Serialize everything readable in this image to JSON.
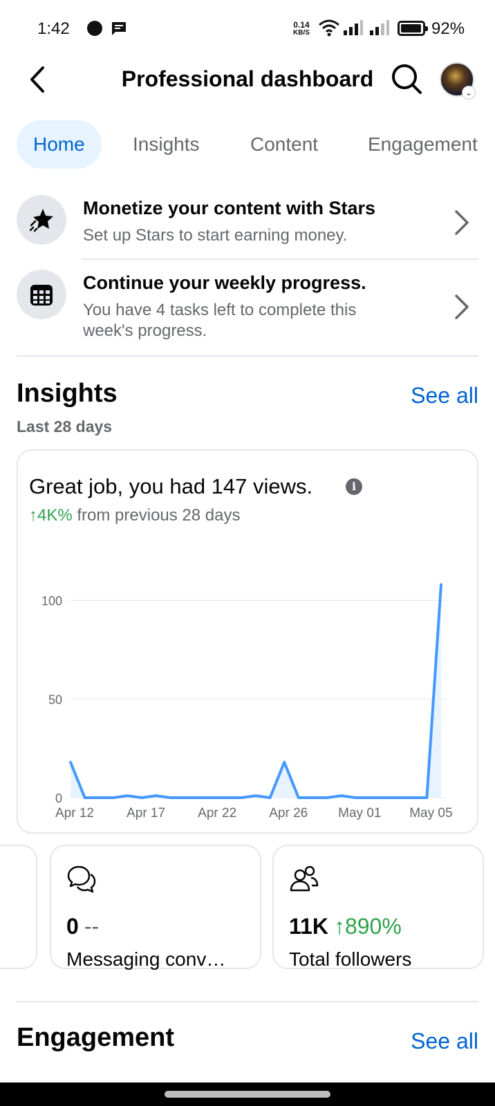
{
  "status_bar": {
    "time": "1:42",
    "net_speed_value": "0.14",
    "net_speed_unit": "KB/S",
    "battery": "92%"
  },
  "header": {
    "title": "Professional dashboard",
    "back_icon": "back-arrow-icon",
    "search_icon": "search-icon"
  },
  "tabs": [
    {
      "label": "Home",
      "active": true
    },
    {
      "label": "Insights",
      "active": false
    },
    {
      "label": "Content",
      "active": false
    },
    {
      "label": "Engagement",
      "active": false
    }
  ],
  "tasks": [
    {
      "title": "Monetize your content with Stars",
      "subtitle": "Set up Stars to start earning money.",
      "icon": "stars-icon"
    },
    {
      "title": "Continue your weekly progress.",
      "subtitle": "You have 4 tasks left to complete this week's progress.",
      "icon": "calendar-icon"
    }
  ],
  "insights": {
    "title": "Insights",
    "see_all": "See all",
    "period": "Last 28 days",
    "headline": "Great job, you had 147 views.",
    "delta_value": "↑4K%",
    "delta_text": "from previous 28 days"
  },
  "chart_data": {
    "type": "area",
    "x_tick_labels": [
      "Apr 12",
      "Apr 17",
      "Apr 22",
      "Apr 26",
      "May 01",
      "May 05"
    ],
    "x_tick_index": [
      0,
      5,
      10,
      15,
      20,
      25
    ],
    "y_ticks": [
      0,
      50,
      100
    ],
    "ylim": [
      0,
      110
    ],
    "values": [
      18,
      0,
      0,
      0,
      1,
      0,
      1,
      0,
      0,
      0,
      0,
      0,
      0,
      1,
      0,
      18,
      0,
      0,
      0,
      1,
      0,
      0,
      0,
      0,
      0,
      0,
      108
    ],
    "grid": true,
    "line_color": "#4599ff",
    "fill_color": "#e7f3ff"
  },
  "metrics": [
    {
      "value": "0",
      "extra": "--",
      "label": "Messaging conv…",
      "icon": "chat-bubbles-icon"
    },
    {
      "value": "11K",
      "extra": "↑890%",
      "label": "Total followers",
      "icon": "followers-icon"
    }
  ],
  "engagement": {
    "title": "Engagement",
    "see_all": "See all"
  },
  "colors": {
    "accent": "#0064d1",
    "positive": "#31a24c",
    "muted": "#65676b"
  }
}
